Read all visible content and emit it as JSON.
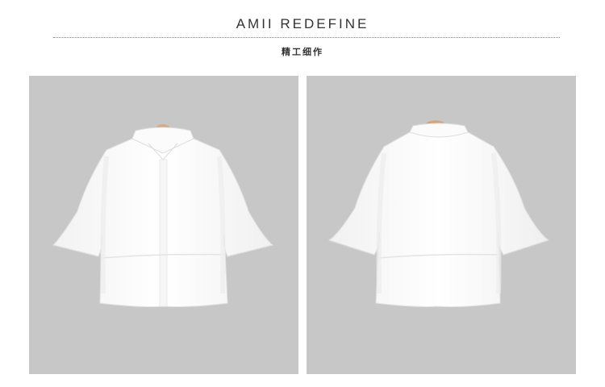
{
  "header": {
    "brand": "AMII REDEFINE",
    "subtitle": "精工细作"
  },
  "colors": {
    "panel_bg": "#c7c7c7",
    "garment": "#ffffff",
    "hanger": "#c89a6e"
  },
  "gallery": {
    "images": [
      {
        "name": "shirt-front-image",
        "view": "front"
      },
      {
        "name": "shirt-back-image",
        "view": "back"
      }
    ]
  }
}
